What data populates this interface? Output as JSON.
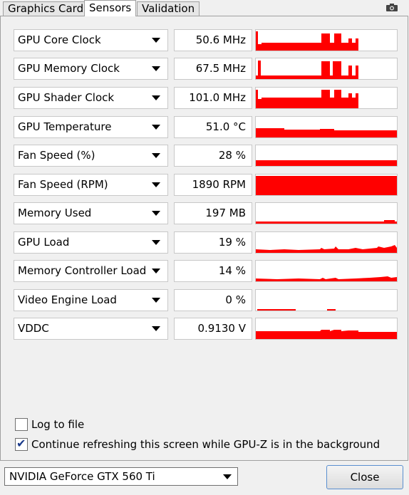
{
  "tabs": [
    "Graphics Card",
    "Sensors",
    "Validation"
  ],
  "active_tab": "Sensors",
  "colors": {
    "graph": "#ff0000",
    "panel": "#f0f0f0"
  },
  "sensors": [
    {
      "name": "GPU Core Clock",
      "value": "50.6 MHz"
    },
    {
      "name": "GPU Memory Clock",
      "value": "67.5 MHz"
    },
    {
      "name": "GPU Shader Clock",
      "value": "101.0 MHz"
    },
    {
      "name": "GPU Temperature",
      "value": "51.0 °C"
    },
    {
      "name": "Fan Speed (%)",
      "value": "28 %"
    },
    {
      "name": "Fan Speed (RPM)",
      "value": "1890 RPM"
    },
    {
      "name": "Memory Used",
      "value": "197 MB"
    },
    {
      "name": "GPU Load",
      "value": "19 %"
    },
    {
      "name": "Memory Controller Load",
      "value": "14 %"
    },
    {
      "name": "Video Engine Load",
      "value": "0 %"
    },
    {
      "name": "VDDC",
      "value": "0.9130 V"
    }
  ],
  "options": {
    "log_to_file": {
      "label": "Log to file",
      "checked": false
    },
    "continue_refresh": {
      "label": "Continue refreshing this screen while GPU-Z is in the background",
      "checked": true
    }
  },
  "footer": {
    "gpu_select": "NVIDIA GeForce GTX 560 Ti",
    "close_label": "Close"
  }
}
